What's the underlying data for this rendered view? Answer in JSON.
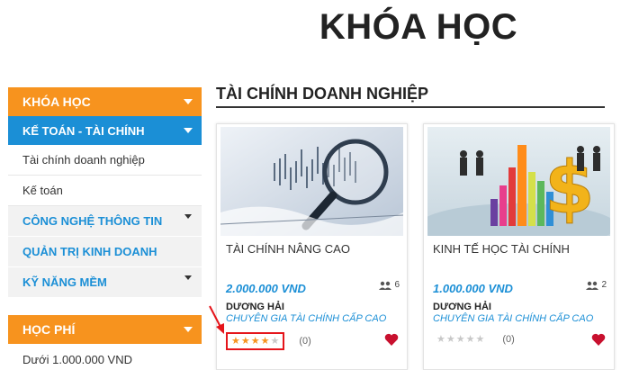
{
  "header": {
    "title": "KHÓA HỌC"
  },
  "sidebar": {
    "courses_header": "KHÓA HỌC",
    "active_category": "KẾ TOÁN - TÀI CHÍNH",
    "subitems": [
      "Tài chính doanh nghiệp",
      "Kế toán"
    ],
    "categories": [
      "CÔNG NGHỆ THÔNG TIN",
      "QUẢN TRỊ KINH DOANH",
      "KỸ NĂNG MỀM"
    ],
    "fee_header": "HỌC PHÍ",
    "fee_items": [
      "Dưới 1.000.000 VND"
    ]
  },
  "section": {
    "title": "TÀI CHÍNH DOANH NGHIỆP"
  },
  "courses": [
    {
      "name": "TÀI CHÍNH NÂNG CAO",
      "price": "2.000.000 VND",
      "students": "6",
      "teacher": "DƯƠNG HẢI",
      "role": "CHUYÊN GIA TÀI CHÍNH CẤP CAO",
      "rating": 4,
      "review_count": "(0)",
      "image": "financial-chart-magnifier"
    },
    {
      "name": "KINH TẾ HỌC TÀI CHÍNH",
      "price": "1.000.000 VND",
      "students": "2",
      "teacher": "DƯƠNG HẢI",
      "role": "CHUYÊN GIA TÀI CHÍNH CẤP CAO",
      "rating": 0,
      "review_count": "(0)",
      "image": "dollar-sign-bar-chart-handshake"
    }
  ],
  "colors": {
    "orange": "#f7931e",
    "blue": "#1b8fd6",
    "red": "#e5151b"
  }
}
